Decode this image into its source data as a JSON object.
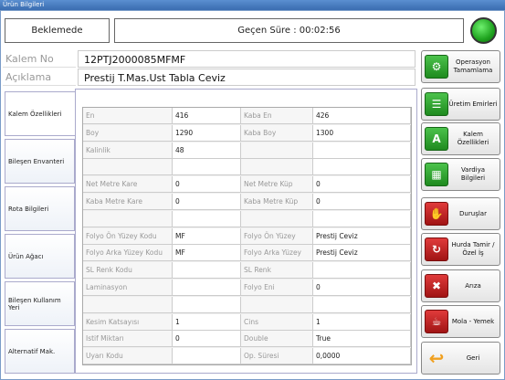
{
  "window": {
    "title": "Ürün Bilgileri"
  },
  "status": {
    "state": "Beklemede",
    "elapsed": "Geçen Süre : 00:02:56",
    "light_color": "#1fa31f"
  },
  "info": [
    {
      "label": "Kalem No",
      "value": "12PTJ2000085MFMF"
    },
    {
      "label": "Açıklama",
      "value": "Prestij T.Mas.Ust Tabla Ceviz"
    }
  ],
  "tabs": [
    "Kalem Özellikleri",
    "Bileşen Envanteri",
    "Rota Bilgileri",
    "Ürün Ağacı",
    "Bileşen Kullanım Yeri",
    "Alternatif Mak."
  ],
  "properties": [
    {
      "l1": "En",
      "v1": "416",
      "l2": "Kaba En",
      "v2": "426"
    },
    {
      "l1": "Boy",
      "v1": "1290",
      "l2": "Kaba Boy",
      "v2": "1300"
    },
    {
      "l1": "Kalinlik",
      "v1": "48",
      "l2": "",
      "v2": ""
    },
    {
      "l1": "",
      "v1": "",
      "l2": "",
      "v2": ""
    },
    {
      "l1": "Net Metre Kare",
      "v1": "0",
      "l2": "Net Metre Küp",
      "v2": "0"
    },
    {
      "l1": "Kaba Metre Kare",
      "v1": "0",
      "l2": "Kaba Metre Küp",
      "v2": "0"
    },
    {
      "l1": "",
      "v1": "",
      "l2": "",
      "v2": ""
    },
    {
      "l1": "Folyo Ön Yüzey Kodu",
      "v1": "MF",
      "l2": "Folyo Ön Yüzey",
      "v2": "Prestij Ceviz"
    },
    {
      "l1": "Folyo Arka Yüzey Kodu",
      "v1": "MF",
      "l2": "Folyo Arka Yüzey",
      "v2": "Prestij Ceviz"
    },
    {
      "l1": "SL Renk Kodu",
      "v1": "",
      "l2": "SL Renk",
      "v2": ""
    },
    {
      "l1": "Laminasyon",
      "v1": "",
      "l2": "Folyo Eni",
      "v2": "0"
    },
    {
      "l1": "",
      "v1": "",
      "l2": "",
      "v2": ""
    },
    {
      "l1": "Kesim Katsayısı",
      "v1": "1",
      "l2": "Cins",
      "v2": "1"
    },
    {
      "l1": "Istif Miktarı",
      "v1": "0",
      "l2": "Double",
      "v2": "True"
    },
    {
      "l1": "Uyarı Kodu",
      "v1": "",
      "l2": "Op. Süresi",
      "v2": "0,0000"
    }
  ],
  "actions": [
    {
      "label": "Operasyon Tamamlama",
      "icon": "gear-icon",
      "color": "green",
      "glyph": "⚙"
    },
    {
      "label": "Üretim Emirleri",
      "icon": "list-icon",
      "color": "green",
      "glyph": "☰"
    },
    {
      "label": "Kalem Özellikleri",
      "icon": "document-icon",
      "color": "green",
      "glyph": "A"
    },
    {
      "label": "Vardiya Bilgileri",
      "icon": "calendar-icon",
      "color": "green",
      "glyph": "▦"
    },
    {
      "label": "Duruşlar",
      "icon": "stop-icon",
      "color": "red",
      "glyph": "✋"
    },
    {
      "label": "Hurda Tamir / Özel İş",
      "icon": "recycle-icon",
      "color": "red",
      "glyph": "↻"
    },
    {
      "label": "Arıza",
      "icon": "tools-icon",
      "color": "red",
      "glyph": "✖"
    },
    {
      "label": "Mola - Yemek",
      "icon": "coffee-icon",
      "color": "red",
      "glyph": "☕"
    },
    {
      "label": "Geri",
      "icon": "back-arrow-icon",
      "color": "orange",
      "glyph": "↩"
    }
  ]
}
